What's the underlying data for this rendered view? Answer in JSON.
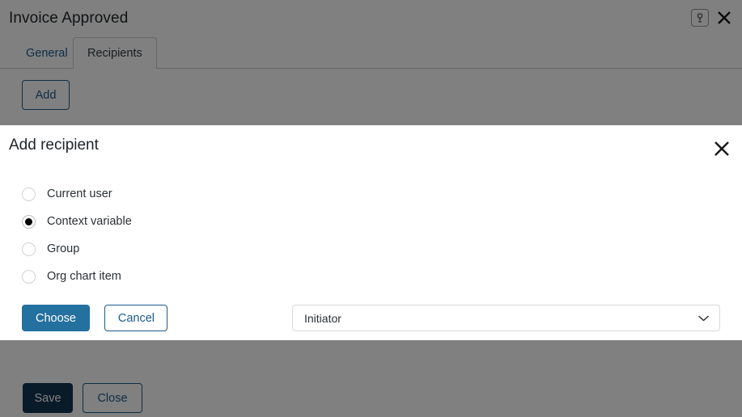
{
  "window": {
    "title": "Invoice Approved",
    "help_icon": "help-icon",
    "close_icon": "close-icon"
  },
  "tabs": [
    {
      "label": "General",
      "active": false
    },
    {
      "label": "Recipients",
      "active": true
    }
  ],
  "toolbar": {
    "add_label": "Add"
  },
  "footer": {
    "save_label": "Save",
    "close_label": "Close"
  },
  "dialog": {
    "title": "Add recipient",
    "close_icon": "close-icon",
    "options": [
      {
        "label": "Current user",
        "selected": false
      },
      {
        "label": "Context variable",
        "selected": true
      },
      {
        "label": "Group",
        "selected": false
      },
      {
        "label": "Org chart item",
        "selected": false
      }
    ],
    "select": {
      "value": "Initiator",
      "chevron_icon": "chevron-down-icon"
    },
    "choose_label": "Choose",
    "cancel_label": "Cancel"
  },
  "colors": {
    "accent_blue": "#1d5b8c",
    "primary_button": "#24709f",
    "save_button": "#123753",
    "overlay": "#808080",
    "text": "#22262a"
  }
}
